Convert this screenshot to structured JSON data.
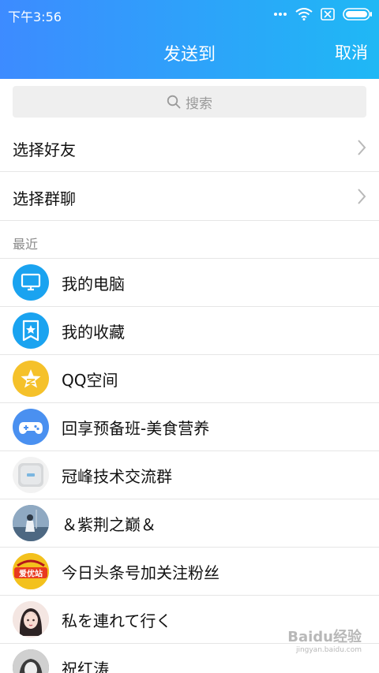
{
  "status": {
    "time": "下午3:56"
  },
  "header": {
    "title": "发送到",
    "cancel_label": "取消"
  },
  "search": {
    "placeholder": "搜索"
  },
  "nav": [
    {
      "label": "选择好友"
    },
    {
      "label": "选择群聊"
    }
  ],
  "section": {
    "recent_label": "最近"
  },
  "recent": [
    {
      "name": "我的电脑",
      "icon": "computer-icon",
      "color": "#1aa3f0"
    },
    {
      "name": "我的收藏",
      "icon": "favorites-icon",
      "color": "#1aa3f0"
    },
    {
      "name": "QQ空间",
      "icon": "qzone-star-icon",
      "color": "#f5c12a"
    },
    {
      "name": "回享预备班-美食营养",
      "icon": "gamepad-icon",
      "color": "#4a90f0"
    },
    {
      "name": "冠峰技术交流群",
      "icon": "device-avatar",
      "color": "#dcdcdc"
    },
    {
      "name": "＆紫荆之巅＆",
      "icon": "person-avatar",
      "color": "#6e8fb0"
    },
    {
      "name": "今日头条号加关注粉丝",
      "icon": "shop-logo-avatar",
      "color": "#e83a1f",
      "logo_text": "爱优站"
    },
    {
      "name": "私を連れて行く",
      "icon": "girl-avatar",
      "color": "#d89aa2"
    },
    {
      "name": "祝红涛",
      "icon": "photo-avatar",
      "color": "#8c8c8c"
    }
  ],
  "watermark": {
    "text": "Baidu经验",
    "sub": "jingyan.baidu.com"
  }
}
